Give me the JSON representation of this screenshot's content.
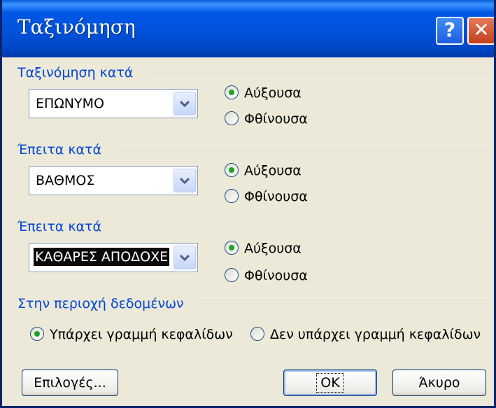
{
  "dialog": {
    "title": "Ταξινόμηση",
    "help_glyph": "?",
    "close_glyph": "✕"
  },
  "sort_by": {
    "label": "Ταξινόμηση κατά",
    "field": "ΕΠΩΝΥΜΟ",
    "ascending": "Αύξουσα",
    "descending": "Φθίνουσα",
    "selected": "ascending"
  },
  "then_by_1": {
    "label": "Έπειτα κατά",
    "field": "ΒΑΘΜΟΣ",
    "ascending": "Αύξουσα",
    "descending": "Φθίνουσα",
    "selected": "ascending"
  },
  "then_by_2": {
    "label": "Έπειτα κατά",
    "field": "ΚΑΘΑΡΕΣ ΑΠΟΔΟΧΕ",
    "ascending": "Αύξουσα",
    "descending": "Φθίνουσα",
    "selected": "ascending"
  },
  "data_range": {
    "label": "Στην περιοχή δεδομένων",
    "has_header": "Υπάρχει γραμμή κεφαλίδων",
    "no_header": "Δεν υπάρχει γραμμή κεφαλίδων",
    "selected": "has_header"
  },
  "buttons": {
    "options": "Επιλογές...",
    "ok": "OK",
    "cancel": "Άκυρο"
  },
  "colors": {
    "title_bar": "#0050d8",
    "section_label": "#0046d5",
    "dialog_bg": "#ece9d8"
  }
}
